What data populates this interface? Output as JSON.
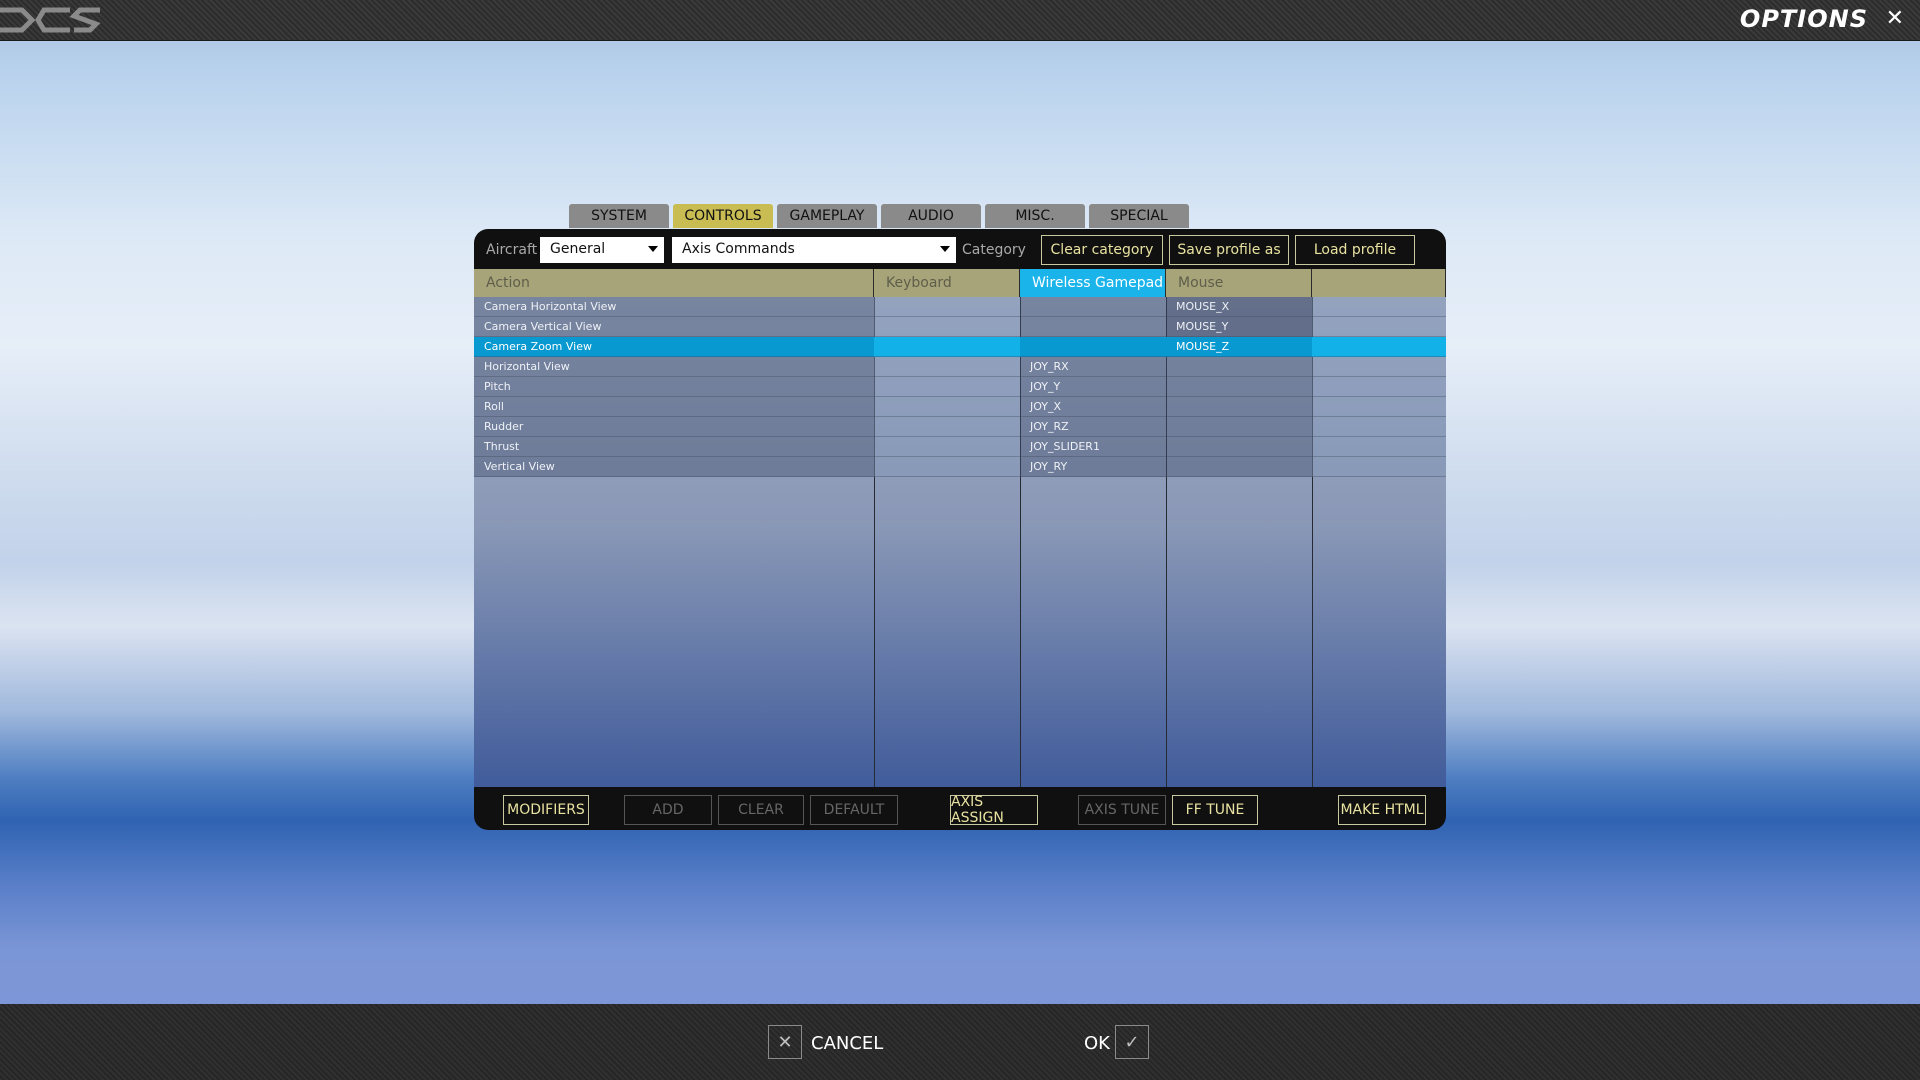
{
  "window": {
    "title": "OPTIONS",
    "close_icon": "close-icon",
    "logo": "DCS"
  },
  "tabs": [
    {
      "label": "SYSTEM",
      "active": false
    },
    {
      "label": "CONTROLS",
      "active": true
    },
    {
      "label": "GAMEPLAY",
      "active": false
    },
    {
      "label": "AUDIO",
      "active": false
    },
    {
      "label": "MISC.",
      "active": false
    },
    {
      "label": "SPECIAL",
      "active": false
    }
  ],
  "toolbar": {
    "aircraft_label": "Aircraft",
    "aircraft_value": "General",
    "category_value": "Axis Commands",
    "category_label": "Category",
    "clear_category": "Clear category",
    "save_profile": "Save profile as",
    "load_profile": "Load profile"
  },
  "columns": [
    "Action",
    "Keyboard",
    "Wireless Gamepad F",
    "Mouse",
    ""
  ],
  "rows": [
    {
      "action": "Camera Horizontal View",
      "keyboard": "",
      "gamepad": "",
      "mouse": "MOUSE_X",
      "extra": ""
    },
    {
      "action": "Camera Vertical View",
      "keyboard": "",
      "gamepad": "",
      "mouse": "MOUSE_Y",
      "extra": ""
    },
    {
      "action": "Camera Zoom View",
      "keyboard": "",
      "gamepad": "",
      "mouse": "MOUSE_Z",
      "extra": "",
      "selected": true
    },
    {
      "action": "Horizontal View",
      "keyboard": "",
      "gamepad": "JOY_RX",
      "mouse": "",
      "extra": ""
    },
    {
      "action": "Pitch",
      "keyboard": "",
      "gamepad": "JOY_Y",
      "mouse": "",
      "extra": ""
    },
    {
      "action": "Roll",
      "keyboard": "",
      "gamepad": "JOY_X",
      "mouse": "",
      "extra": ""
    },
    {
      "action": "Rudder",
      "keyboard": "",
      "gamepad": "JOY_RZ",
      "mouse": "",
      "extra": ""
    },
    {
      "action": "Thrust",
      "keyboard": "",
      "gamepad": "JOY_SLIDER1",
      "mouse": "",
      "extra": ""
    },
    {
      "action": "Vertical View",
      "keyboard": "",
      "gamepad": "JOY_RY",
      "mouse": "",
      "extra": ""
    }
  ],
  "bottom_buttons": {
    "modifiers": "MODIFIERS",
    "add": "ADD",
    "clear": "CLEAR",
    "default": "DEFAULT",
    "axis_assign": "AXIS ASSIGN",
    "axis_tune": "AXIS TUNE",
    "ff_tune": "FF TUNE",
    "make_html": "MAKE HTML"
  },
  "footer": {
    "cancel": "CANCEL",
    "ok": "OK",
    "cancel_icon": "x-icon",
    "ok_icon": "checkmark-icon"
  },
  "colors": {
    "accent_selected": "#0799cf",
    "header_highlight": "#1ab4ea",
    "tab_active": "#c8bc53",
    "button_text": "#e8e2a0"
  }
}
